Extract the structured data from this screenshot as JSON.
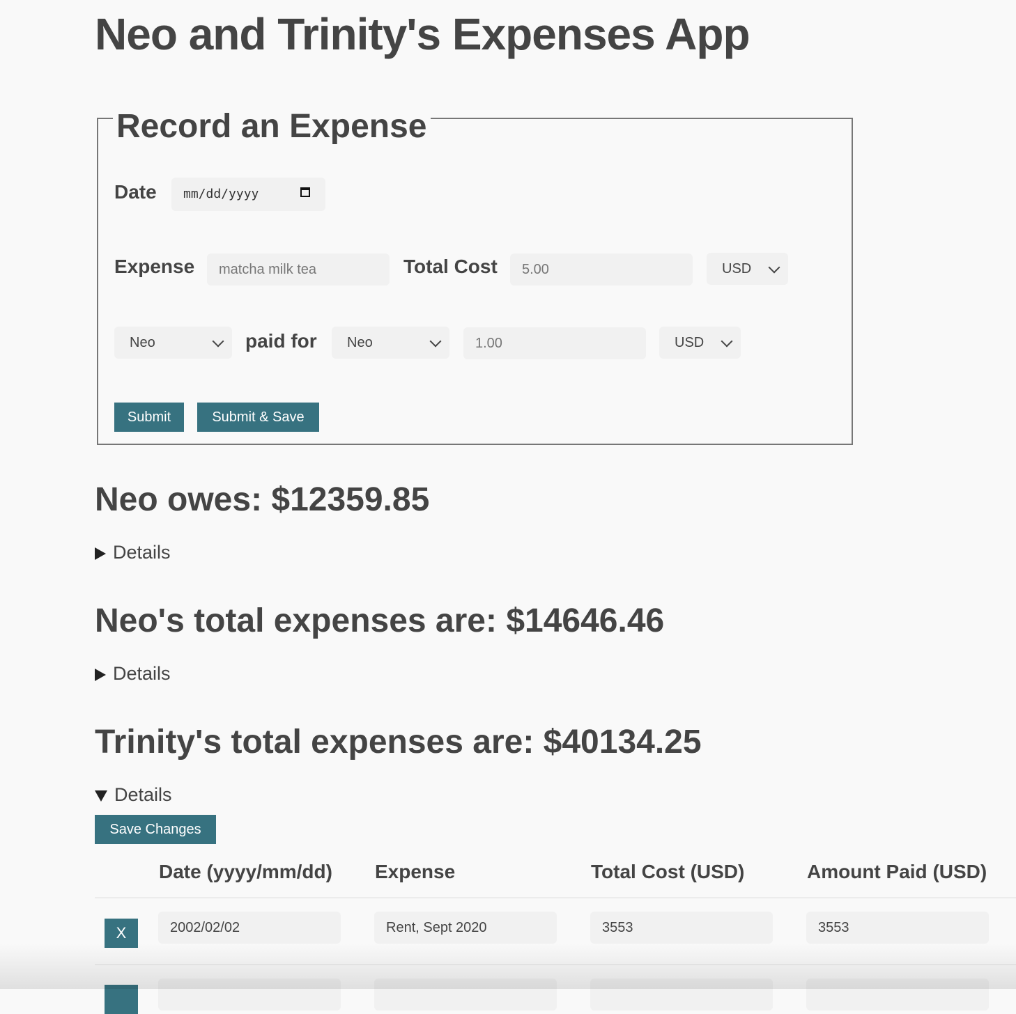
{
  "title": "Neo and Trinity's Expenses App",
  "form": {
    "legend": "Record an Expense",
    "date_label": "Date",
    "date_placeholder": "mm/dd/yyyy",
    "expense_label": "Expense",
    "expense_placeholder": "matcha milk tea",
    "total_cost_label": "Total Cost",
    "total_cost_placeholder": "5.00",
    "currency_1": "USD",
    "payer": "Neo",
    "paid_for_label": "paid for",
    "payee": "Neo",
    "amount_placeholder": "1.00",
    "currency_2": "USD",
    "submit_label": "Submit",
    "submit_save_label": "Submit & Save"
  },
  "summaries": [
    {
      "heading": "Neo owes: $12359.85",
      "details": "Details",
      "open": false
    },
    {
      "heading": "Neo's total expenses are: $14646.46",
      "details": "Details",
      "open": false
    },
    {
      "heading": "Trinity's total expenses are: $40134.25",
      "details": "Details",
      "open": true
    }
  ],
  "table": {
    "save_changes_label": "Save Changes",
    "headers": [
      "Date (yyyy/mm/dd)",
      "Expense",
      "Total Cost (USD)",
      "Amount Paid (USD)"
    ],
    "delete_label": "X",
    "rows": [
      {
        "date": "2002/02/02",
        "expense": "Rent, Sept 2020",
        "total": "3553",
        "paid": "3553"
      }
    ]
  },
  "colors": {
    "accent": "#377280",
    "text": "#444444",
    "background": "#f9f9f9"
  }
}
